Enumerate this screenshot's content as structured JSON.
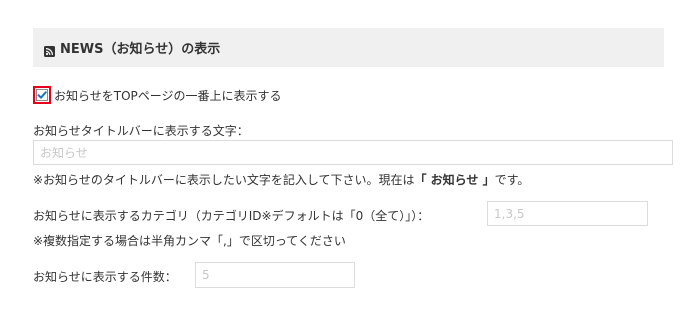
{
  "section": {
    "icon": "rss-icon",
    "title": "NEWS（お知らせ）の表示"
  },
  "show_on_top": {
    "checked": true,
    "label": "お知らせをTOPページの一番上に表示する"
  },
  "title_bar_text": {
    "label": "お知らせタイトルバーに表示する文字：",
    "placeholder": "お知らせ",
    "note_prefix": "※お知らせのタイトルバーに表示したい文字を記入して下さい。現在は",
    "note_current": "「 お知らせ 」",
    "note_suffix": "です。"
  },
  "category": {
    "label": "お知らせに表示するカテゴリ（カテゴリID※デフォルトは「0（全て）」）：",
    "placeholder": "1,3,5",
    "note": "※複数指定する場合は半角カンマ「,」で区切ってください"
  },
  "count": {
    "label": "お知らせに表示する件数：",
    "placeholder": "5"
  },
  "colors": {
    "header_bg": "#f0f0f0",
    "highlight_red": "#e6001e",
    "check_blue": "#1e73be"
  }
}
